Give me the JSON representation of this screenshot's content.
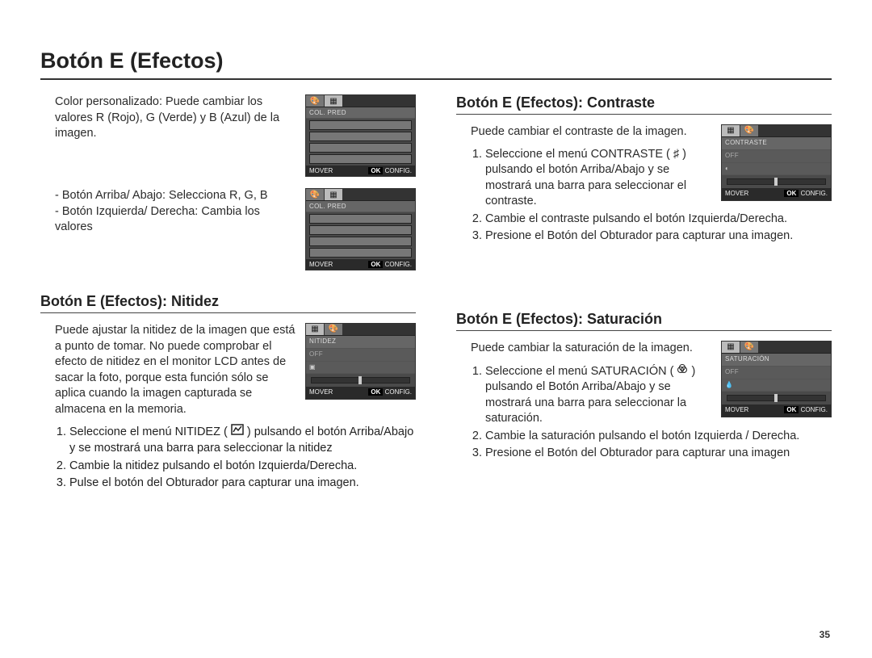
{
  "page": {
    "title": "Botón E (Efectos)",
    "number": "35"
  },
  "left": {
    "custom_color_intro": "Color personalizado: Puede cambiar los valores R (Rojo), G (Verde) y B (Azul) de la imagen.",
    "btn_updown": "- Botón Arriba/ Abajo: Selecciona R, G, B",
    "btn_leftright": "- Botón Izquierda/ Derecha: Cambia los valores",
    "nitidez": {
      "heading": "Botón E (Efectos): Nitidez",
      "intro": "Puede ajustar la nitidez de la imagen que está a punto de tomar. No puede comprobar el efecto de nitidez en el monitor LCD antes de sacar la foto, porque esta función sólo se aplica cuando la imagen capturada se almacena en la memoria.",
      "step1_pre": "Seleccione el menú NITIDEZ ( ",
      "step1_post": " ) pulsando el botón Arriba/Abajo y se mostrará una barra para seleccionar la nitidez",
      "step2": "Cambie la nitidez pulsando el botón Izquierda/Derecha.",
      "step3": "Pulse el botón del Obturador para capturar una imagen."
    }
  },
  "right": {
    "contraste": {
      "heading": "Botón E (Efectos): Contraste",
      "intro": "Puede cambiar el contraste de la imagen.",
      "step1": "Seleccione el menú CONTRASTE ( ♯ ) pulsando el botón Arriba/Abajo y se mostrará una barra para seleccionar el contraste.",
      "step2": "Cambie el contraste pulsando el botón Izquierda/Derecha.",
      "step3": "Presione el Botón del Obturador para capturar una imagen."
    },
    "saturacion": {
      "heading": "Botón E (Efectos): Saturación",
      "intro": "Puede cambiar la saturación de la imagen.",
      "step1_pre": "Seleccione el menú SATURACIÓN ( ",
      "step1_post": " ) pulsando el Botón Arriba/Abajo y se mostrará una barra para seleccionar la saturación.",
      "step2": "Cambie la saturación pulsando el botón Izquierda / Derecha.",
      "step3": "Presione el Botón del Obturador para capturar una imagen"
    }
  },
  "lcd": {
    "col_pred": "COL. PRED",
    "nitidez": "NITIDEZ",
    "contraste": "CONTRASTE",
    "saturacion": "SATURACIÓN",
    "off": "OFF",
    "mover": "MOVER",
    "ok": "OK",
    "config": "CONFIG."
  }
}
